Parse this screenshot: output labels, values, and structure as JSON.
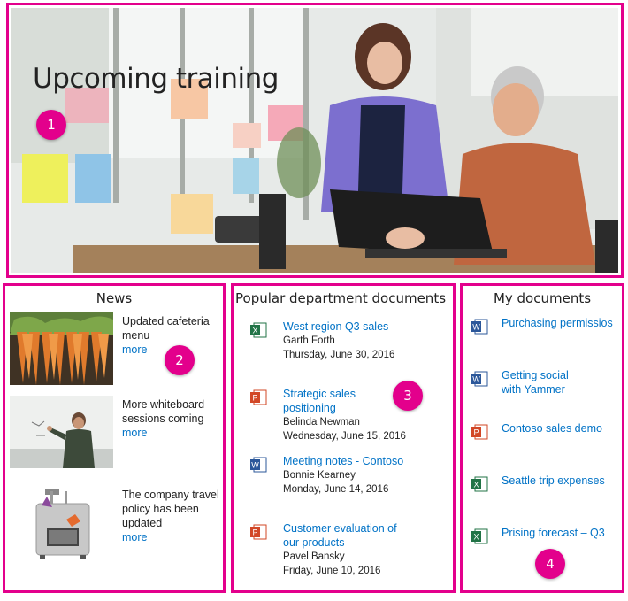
{
  "hero": {
    "title": "Upcoming training",
    "badge": "1"
  },
  "news": {
    "title": "News",
    "badge": "2",
    "items": [
      {
        "headline": "Updated cafeteria menu",
        "more": "more",
        "image": "carrots-photo"
      },
      {
        "headline": "More whiteboard sessions coming",
        "more": "more",
        "image": "whiteboard-photo"
      },
      {
        "headline": "The company travel policy has been updated",
        "more": "more",
        "image": "luggage-illustration"
      }
    ]
  },
  "popular": {
    "title": "Popular department documents",
    "badge": "3",
    "items": [
      {
        "name": "West region Q3 sales",
        "author": "Garth Forth",
        "date": "Thursday, June 30, 2016",
        "type": "excel"
      },
      {
        "name": "Strategic sales positioning",
        "author": "Belinda Newman",
        "date": "Wednesday, June 15, 2016",
        "type": "powerpoint"
      },
      {
        "name": "Meeting notes - Contoso",
        "author": "Bonnie Kearney",
        "date": "Monday, June 14, 2016",
        "type": "word"
      },
      {
        "name": "Customer evaluation of our products",
        "author": "Pavel Bansky",
        "date": "Friday, June 10, 2016",
        "type": "powerpoint"
      }
    ]
  },
  "mydocs": {
    "title": "My documents",
    "badge": "4",
    "items": [
      {
        "name": "Purchasing permissios",
        "type": "word"
      },
      {
        "name": "Getting social with Yammer",
        "type": "word"
      },
      {
        "name": "Contoso sales demo",
        "type": "powerpoint"
      },
      {
        "name": "Seattle trip expenses",
        "type": "excel"
      },
      {
        "name": "Prising forecast – Q3",
        "type": "excel"
      }
    ]
  },
  "colors": {
    "accent": "#e3008c",
    "link": "#0072c6",
    "word": "#2b579a",
    "excel": "#217346",
    "powerpoint": "#d24726"
  }
}
